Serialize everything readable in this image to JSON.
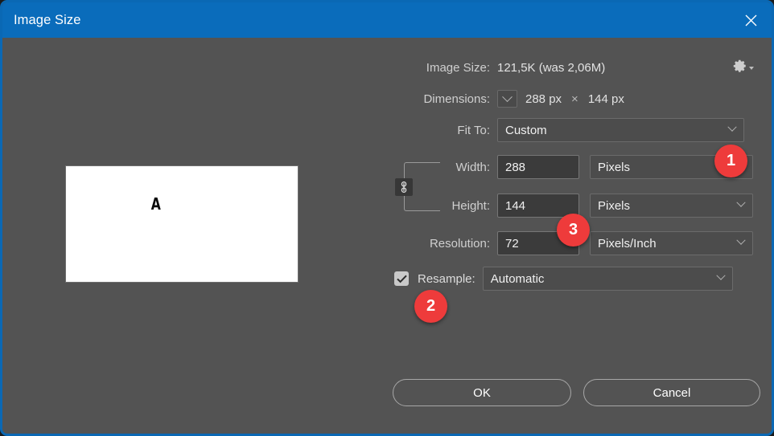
{
  "window": {
    "title": "Image Size",
    "close_icon": "close-icon",
    "accent_color": "#0a6cbb",
    "background_color": "#535353"
  },
  "preview": {
    "glyph": "A",
    "canvas_color": "#ffffff"
  },
  "form": {
    "image_size": {
      "label": "Image Size:",
      "value": "121,5K (was 2,06M)",
      "gear_icon": "gear-icon"
    },
    "dimensions": {
      "label": "Dimensions:",
      "dropdown_icon": "chevron-down-icon",
      "width": "288 px",
      "separator": "×",
      "height": "144 px"
    },
    "fit_to": {
      "label": "Fit To:",
      "value": "Custom"
    },
    "width": {
      "label": "Width:",
      "value": "288",
      "unit": "Pixels"
    },
    "height": {
      "label": "Height:",
      "value": "144",
      "unit": "Pixels"
    },
    "resolution": {
      "label": "Resolution:",
      "value": "72",
      "unit": "Pixels/Inch"
    },
    "resample": {
      "label": "Resample:",
      "checked": true,
      "checkbox_icon": "checkmark-icon",
      "value": "Automatic"
    },
    "chain_icon": "chain-link-icon"
  },
  "footer": {
    "ok_label": "OK",
    "cancel_label": "Cancel"
  },
  "annotations": {
    "color": "#ee3b3b",
    "badges": [
      {
        "number": "1",
        "target": "width-unit-dropdown"
      },
      {
        "number": "2",
        "target": "resample-checkbox"
      },
      {
        "number": "3",
        "target": "resolution-input"
      }
    ]
  }
}
